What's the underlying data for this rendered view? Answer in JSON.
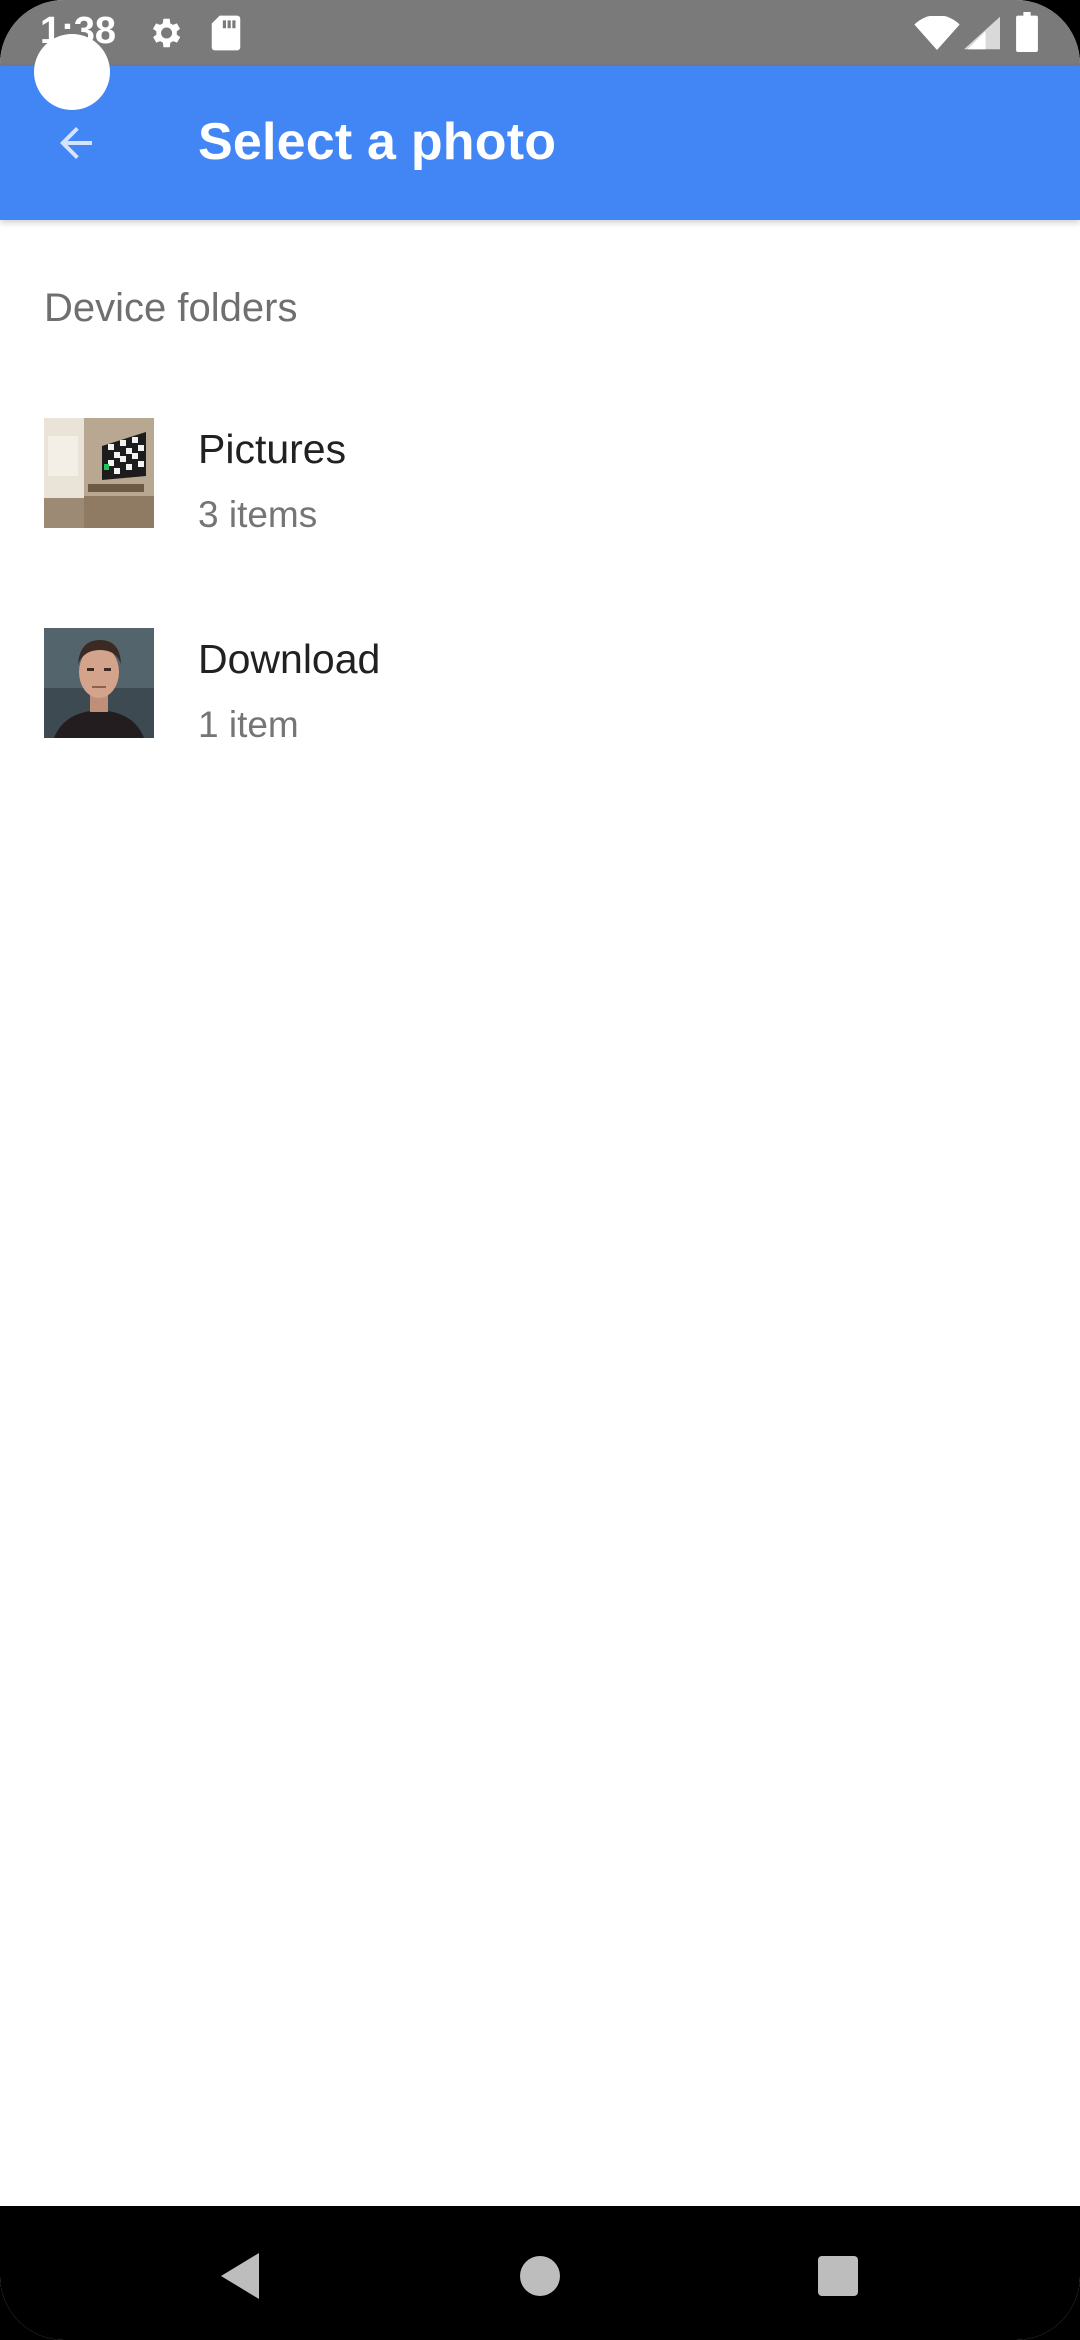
{
  "status_bar": {
    "time": "1:38",
    "icons": [
      "settings-icon",
      "sd-card-icon",
      "wifi-icon",
      "cell-signal-icon",
      "battery-icon"
    ]
  },
  "app_bar": {
    "title": "Select a photo",
    "back_icon": "arrow-back-icon",
    "color": "#4285f4"
  },
  "section": {
    "header": "Device folders"
  },
  "folders": [
    {
      "name": "Pictures",
      "count": "3 items",
      "thumb": "room-thumbnail"
    },
    {
      "name": "Download",
      "count": "1 item",
      "thumb": "portrait-thumbnail"
    }
  ],
  "nav_bar": {
    "buttons": [
      "back-triangle-icon",
      "home-circle-icon",
      "recents-square-icon"
    ]
  }
}
